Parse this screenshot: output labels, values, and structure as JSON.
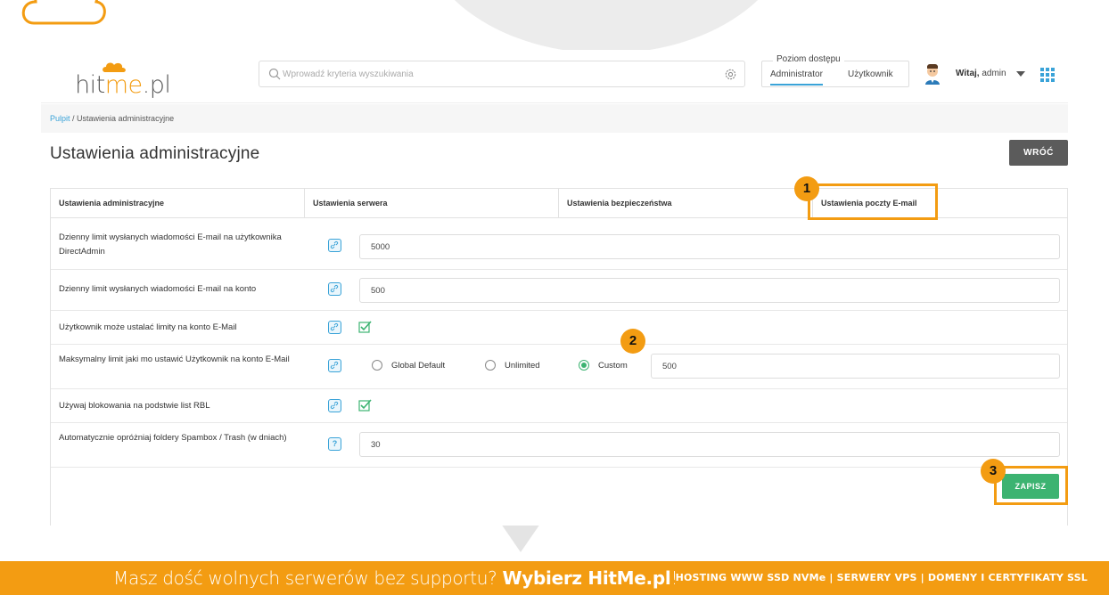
{
  "header": {
    "logo_left": "hit",
    "logo_accent": "me",
    "logo_right": ".pl",
    "search_placeholder": "Wprowadź kryteria wyszukiwania",
    "access_legend": "Poziom dostępu",
    "access_admin": "Administrator",
    "access_user": "Użytkownik",
    "greeting_bold": "Witaj,",
    "greeting_user": " admin"
  },
  "breadcrumb": {
    "home": "Pulpit",
    "sep": " / ",
    "current": "Ustawienia administracyjne"
  },
  "page": {
    "title": "Ustawienia administracyjne",
    "back_label": "WRÓĆ",
    "save_label": "ZAPISZ"
  },
  "tabs": [
    {
      "label": "Ustawienia administracyjne"
    },
    {
      "label": "Ustawienia serwera"
    },
    {
      "label": "Ustawienia bezpieczeństwa"
    },
    {
      "label": "Ustawienia poczty E-mail"
    }
  ],
  "rows": [
    {
      "label": "Dzienny limit wysłanych wiadomości E-mail na użytkownika DirectAdmin",
      "value": "5000"
    },
    {
      "label": "Dzienny limit wysłanych wiadomości E-mail na konto",
      "value": "500"
    },
    {
      "label": "Użytkownik może ustalać limity na konto E-Mail",
      "checked": true
    },
    {
      "label": "Maksymalny limit jaki mo ustawić Użytkownik na konto E-Mail",
      "options": [
        "Global Default",
        "Unlimited",
        "Custom"
      ],
      "selected": "Custom",
      "value": "500"
    },
    {
      "label": "Używaj blokowania na podstwie list RBL",
      "checked": true
    },
    {
      "label": "Automatycznie opróżniaj foldery Spambox / Trash (w dniach)",
      "value": "30"
    }
  ],
  "annotations": [
    "1",
    "2",
    "3"
  ],
  "banner": {
    "text_light": "Masz dość wolnych serwerów bez supportu? ",
    "text_bold": "Wybierz HitMe.pl",
    "text_end": "!",
    "right": "HOSTING WWW SSD NVMe | SERWERY VPS | DOMENY I CERTYFIKATY SSL"
  },
  "colors": {
    "accent": "#3aa3d8",
    "brand_orange": "#f39c12",
    "save_green": "#3cb371",
    "back_grey": "#5b5b5b"
  }
}
